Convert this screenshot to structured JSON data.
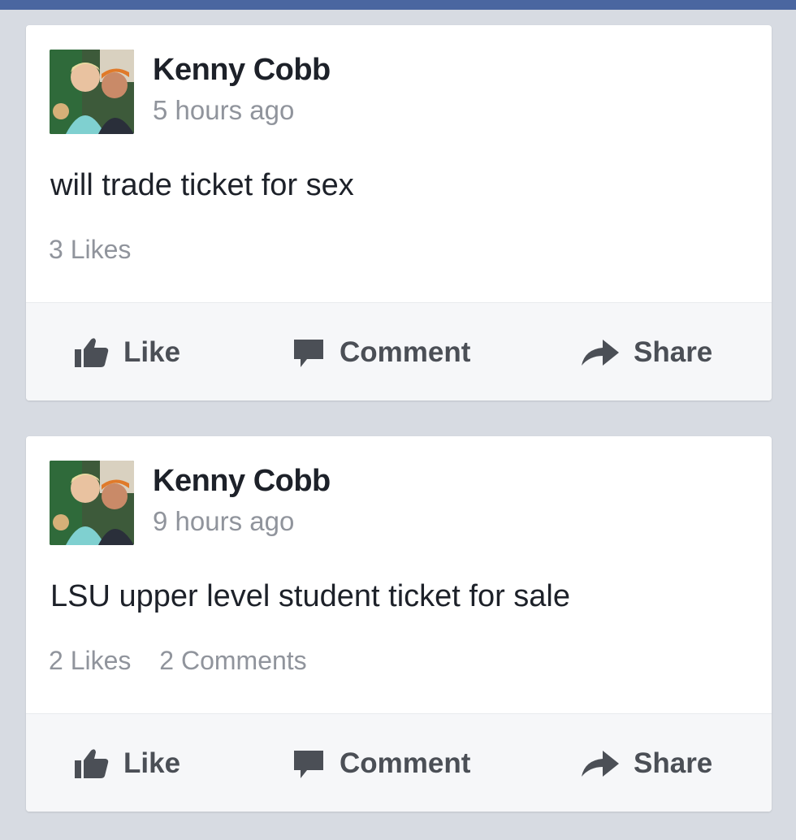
{
  "posts": [
    {
      "author": "Kenny Cobb",
      "time": "5 hours ago",
      "text": "will trade ticket for sex",
      "likes": "3 Likes",
      "comments": "",
      "actions": {
        "like": "Like",
        "comment": "Comment",
        "share": "Share"
      }
    },
    {
      "author": "Kenny Cobb",
      "time": "9 hours ago",
      "text": "LSU upper level student ticket for sale",
      "likes": "2 Likes",
      "comments": "2 Comments",
      "actions": {
        "like": "Like",
        "comment": "Comment",
        "share": "Share"
      }
    }
  ],
  "colors": {
    "brand_bar": "#4a66a0",
    "background": "#d7dbe2",
    "card": "#ffffff",
    "action_bar": "#f6f7f9",
    "text": "#1d2129",
    "meta": "#90949c",
    "action_text": "#4b4f56"
  },
  "icons": [
    "thumbs-up-icon",
    "comment-bubble-icon",
    "share-arrow-icon"
  ]
}
